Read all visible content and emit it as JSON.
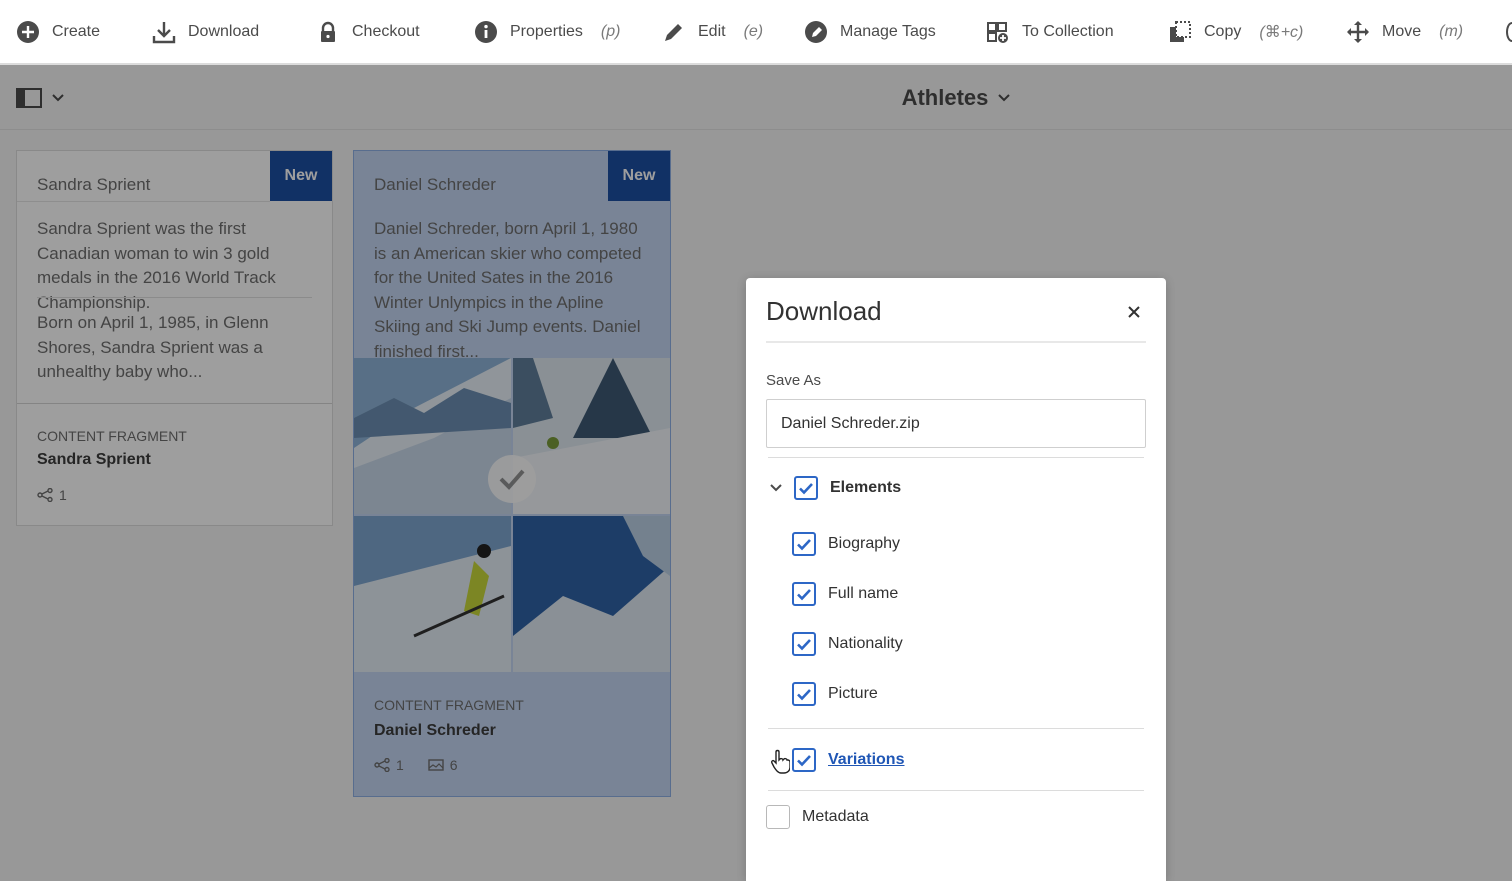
{
  "toolbar": {
    "create": "Create",
    "download": "Download",
    "checkout": "Checkout",
    "properties": "Properties",
    "properties_sc": "(p)",
    "edit": "Edit",
    "edit_sc": "(e)",
    "manage_tags": "Manage Tags",
    "to_collection": "To Collection",
    "copy": "Copy",
    "copy_sc": "(⌘+c)",
    "move": "Move",
    "move_sc": "(m)"
  },
  "header": {
    "title": "Athletes"
  },
  "cards": [
    {
      "name": "Sandra Sprient",
      "badge": "New",
      "desc1": "Sandra Sprient was the first Canadian woman to win 3 gold medals in the 2016 World Track Championship.",
      "desc2": "Born on April 1, 1985, in Glenn Shores, Sandra Sprient was a unhealthy baby who...",
      "type": "CONTENT FRAGMENT",
      "title": "Sandra Sprient",
      "shares": "1"
    },
    {
      "name": "Daniel Schreder",
      "badge": "New",
      "desc1": "Daniel Schreder, born April 1, 1980 is an American skier who competed for the United Sates in the 2016 Winter Unlympics in the Apline Skiing and Ski Jump events. Daniel finished first...",
      "type": "CONTENT FRAGMENT",
      "title": "Daniel Schreder",
      "shares": "1",
      "images": "6"
    }
  ],
  "dialog": {
    "title": "Download",
    "save_as_label": "Save As",
    "save_as_value": "Daniel Schreder.zip",
    "elements_label": "Elements",
    "elements": [
      "Biography",
      "Full name",
      "Nationality",
      "Picture"
    ],
    "variations_label": "Variations",
    "metadata_label": "Metadata"
  },
  "colors": {
    "accent": "#2d67c6",
    "badge": "#1c4fa3"
  }
}
